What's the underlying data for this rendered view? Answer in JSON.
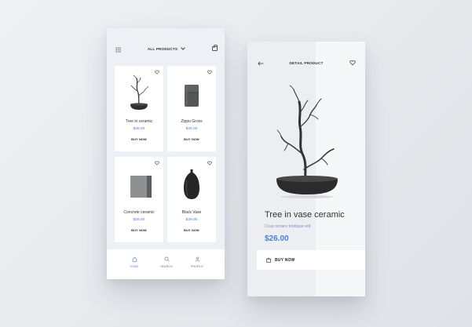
{
  "list_screen": {
    "header": {
      "title": "ALL PRODUCTS"
    },
    "products": [
      {
        "name": "Tree in ceramic",
        "price": "$26.00",
        "buy": "BUY NOW"
      },
      {
        "name": "Zippo Gross",
        "price": "$26.00",
        "buy": "BUY NOW"
      },
      {
        "name": "Concrete ceramic",
        "price": "$26.00",
        "buy": "BUY NOW"
      },
      {
        "name": "Black Vase",
        "price": "$26.00",
        "buy": "BUY NOW"
      }
    ],
    "nav": [
      {
        "label": "HOME",
        "icon": "home-icon",
        "active": true
      },
      {
        "label": "SEARCH",
        "icon": "search-icon",
        "active": false
      },
      {
        "label": "PROFILE",
        "icon": "profile-icon",
        "active": false
      }
    ]
  },
  "detail_screen": {
    "header": {
      "title": "DETAIL PRODUCT"
    },
    "product": {
      "name": "Tree in vase ceramic",
      "subtitle": "Cras ornare tristique elit",
      "price": "$26.00"
    },
    "buy_button": "BUY NOW"
  },
  "colors": {
    "accent": "#4a7fe0",
    "background": "#edf0f4",
    "card": "#ffffff"
  }
}
